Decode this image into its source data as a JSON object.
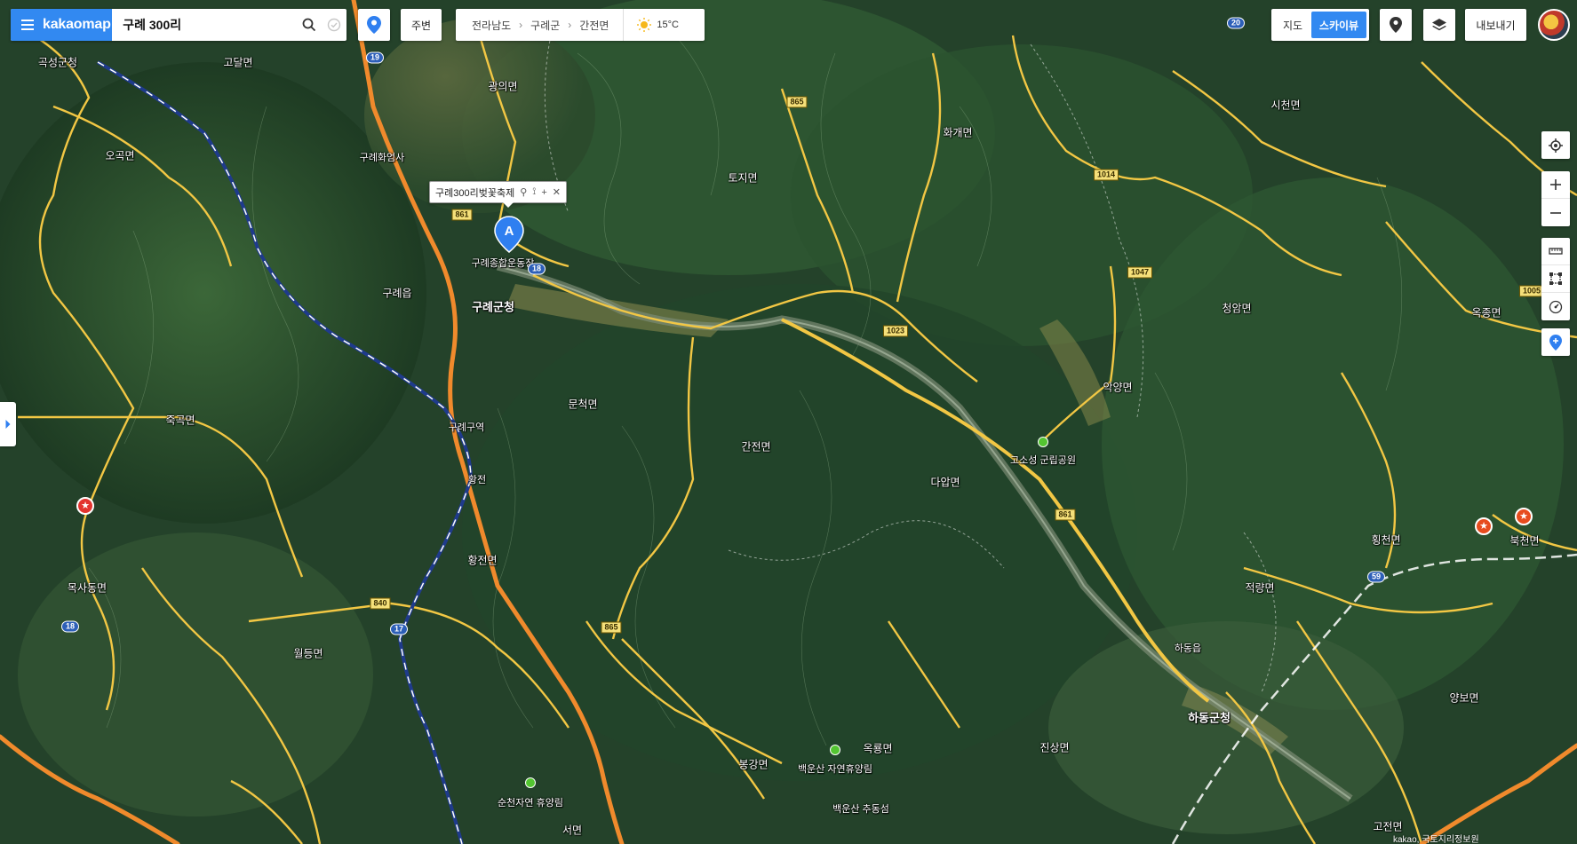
{
  "app": {
    "logo": "kakaomap"
  },
  "search": {
    "query": "구례 300리"
  },
  "toolbar": {
    "around_label": "주변",
    "export_label": "내보내기"
  },
  "location": {
    "province": "전라남도",
    "county": "구례군",
    "town": "간전면",
    "temperature": "15°C"
  },
  "view_toggle": {
    "map_label": "지도",
    "sky_label": "스카이뷰",
    "active": "스카이뷰"
  },
  "popup": {
    "title": "구례300리벚꽃축제",
    "marker_letter": "A"
  },
  "colors": {
    "accent": "#3289f1",
    "road_major": "#f08a2c",
    "road_minor": "#f2c744",
    "rail": "#1f3b8c",
    "poi_green": "#53c531",
    "poi_star": "#e74c1e"
  },
  "map_labels": [
    {
      "text": "곡성군청"
    },
    {
      "text": "고달면"
    },
    {
      "text": "광의면"
    },
    {
      "text": "오곡면"
    },
    {
      "text": "구례화엄사"
    },
    {
      "text": "토지면"
    },
    {
      "text": "화개면"
    },
    {
      "text": "시천면"
    },
    {
      "text": "구례종합운동장"
    },
    {
      "text": "구례읍"
    },
    {
      "text": "구례군청"
    },
    {
      "text": "청암면"
    },
    {
      "text": "옥종면"
    },
    {
      "text": "악양면"
    },
    {
      "text": "문척면"
    },
    {
      "text": "죽곡면"
    },
    {
      "text": "구례구역"
    },
    {
      "text": "간전면"
    },
    {
      "text": "고소성 군립공원"
    },
    {
      "text": "다압면"
    },
    {
      "text": "횡천면"
    },
    {
      "text": "북천면"
    },
    {
      "text": "황전"
    },
    {
      "text": "황전면"
    },
    {
      "text": "목사동면"
    },
    {
      "text": "적량면"
    },
    {
      "text": "월등면"
    },
    {
      "text": "하동읍"
    },
    {
      "text": "하동군청"
    },
    {
      "text": "양보면"
    },
    {
      "text": "백운산 자연휴양림"
    },
    {
      "text": "옥룡면"
    },
    {
      "text": "진상면"
    },
    {
      "text": "봉강면"
    },
    {
      "text": "백운산 추동섬"
    },
    {
      "text": "순천자연 휴양림"
    },
    {
      "text": "서면"
    },
    {
      "text": "고전면"
    }
  ],
  "route_numbers": [
    "19",
    "865",
    "861",
    "18",
    "1023",
    "1047",
    "1014",
    "1005",
    "861",
    "840",
    "17",
    "865",
    "18",
    "59",
    "20"
  ],
  "copyright": "kakao, 국토지리정보원"
}
